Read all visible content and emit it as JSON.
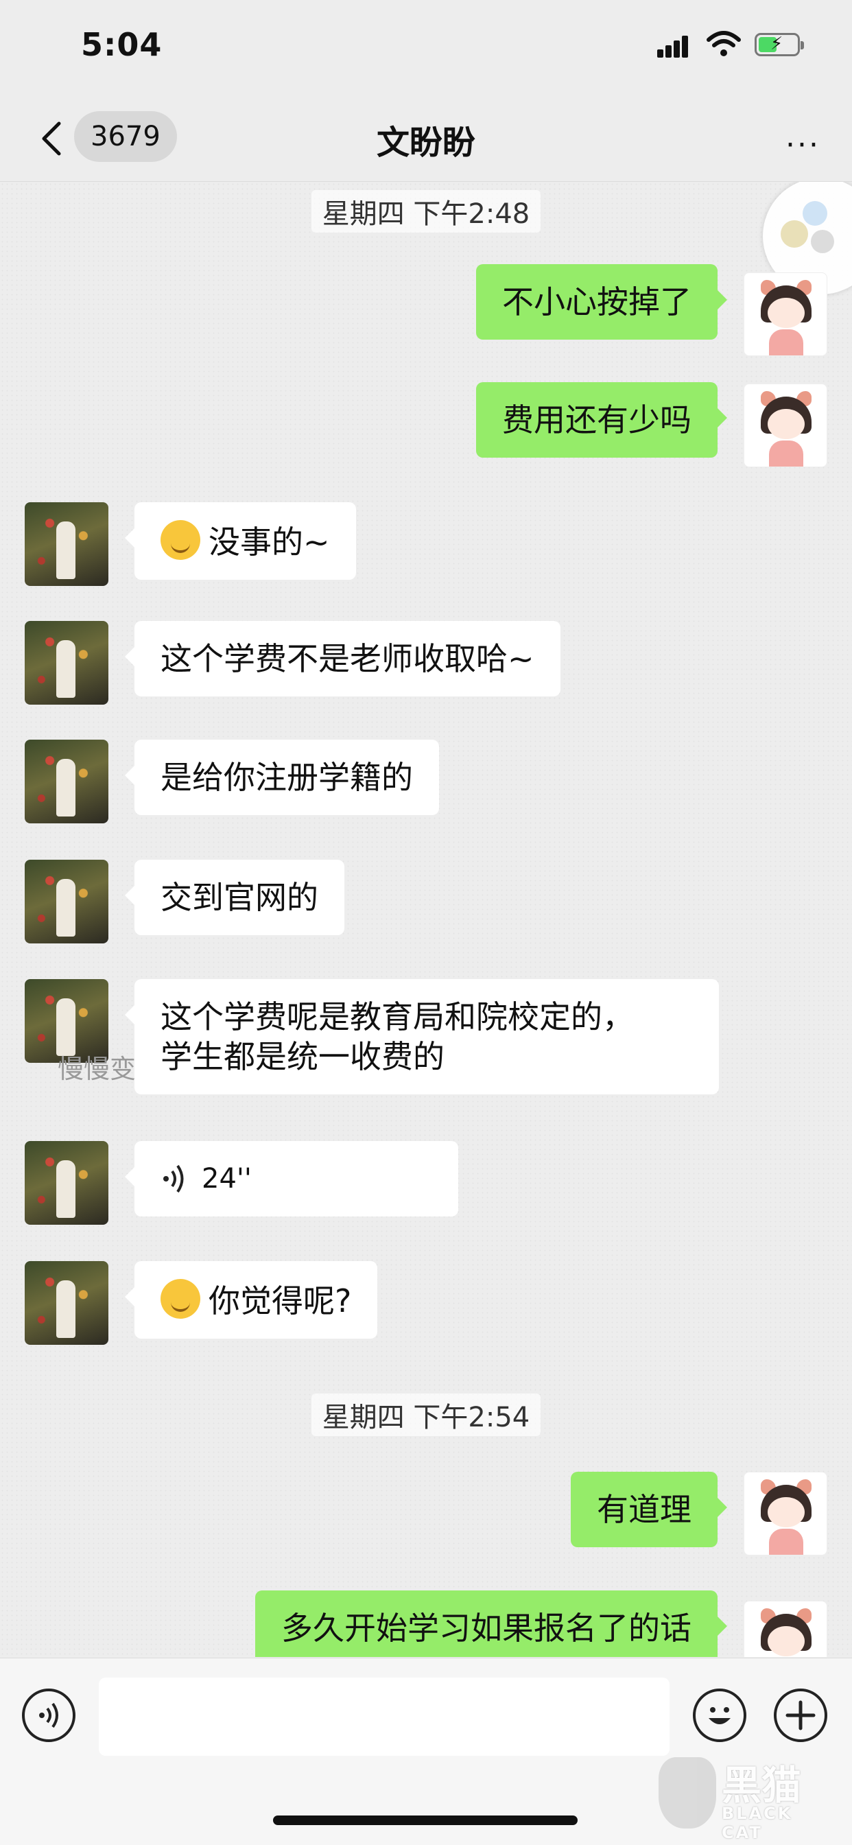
{
  "status": {
    "time": "5:04"
  },
  "nav": {
    "badge": "3679",
    "title": "文盼盼",
    "more": "···"
  },
  "messages": {
    "ts1": "星期四 下午2:48",
    "m1": "不小心按掉了",
    "m2": "费用还有少吗",
    "m3": "没事的~",
    "m4": "这个学费不是老师收取哈~",
    "m5": "是给你注册学籍的",
    "m6": "交到官网的",
    "m7_line1": "这个学费呢是教育局和院校定的，",
    "m7_line2": "学生都是统一收费的",
    "nickname": "慢慢变",
    "voice": "24''",
    "m9": "你觉得呢?",
    "ts2": "星期四 下午2:54",
    "m10": "有道理",
    "m11": "多久开始学习如果报名了的话"
  },
  "watermark": {
    "big": "黑猫",
    "small": "BLACK CAT"
  },
  "icons": [
    "back-icon",
    "signal-icon",
    "wifi-icon",
    "battery-icon",
    "more-icon",
    "voice-input-icon",
    "emoji-icon",
    "plus-icon"
  ]
}
